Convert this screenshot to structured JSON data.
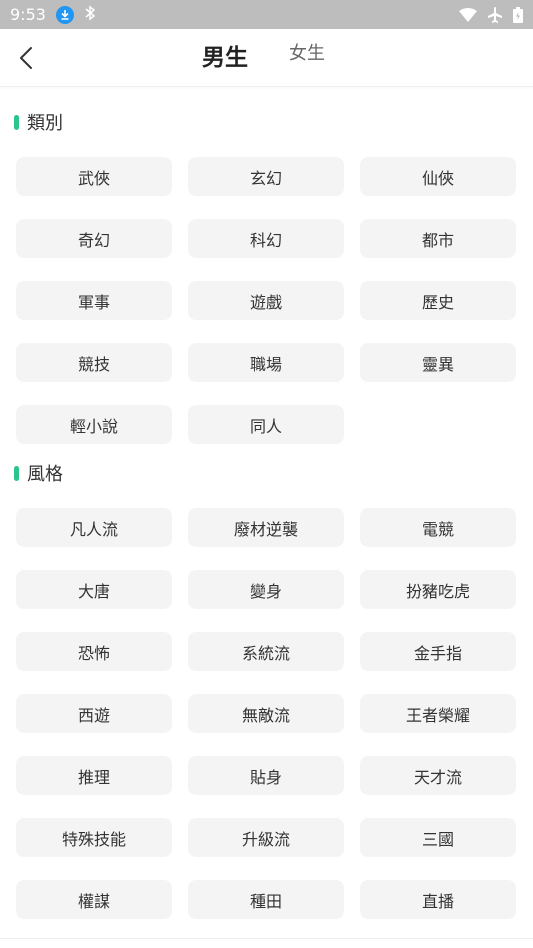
{
  "status_bar": {
    "time": "9:53"
  },
  "header": {
    "tabs": [
      {
        "label": "男生",
        "active": true
      },
      {
        "label": "女生",
        "active": false
      }
    ],
    "accent": "#2bc48a"
  },
  "sections": [
    {
      "title": "類別",
      "items": [
        "武俠",
        "玄幻",
        "仙俠",
        "奇幻",
        "科幻",
        "都市",
        "軍事",
        "遊戲",
        "歷史",
        "競技",
        "職場",
        "靈異",
        "輕小說",
        "同人"
      ]
    },
    {
      "title": "風格",
      "items": [
        "凡人流",
        "廢材逆襲",
        "電競",
        "大唐",
        "變身",
        "扮豬吃虎",
        "恐怖",
        "系統流",
        "金手指",
        "西遊",
        "無敵流",
        "王者榮耀",
        "推理",
        "貼身",
        "天才流",
        "特殊技能",
        "升級流",
        "三國",
        "權謀",
        "種田",
        "直播"
      ]
    }
  ]
}
